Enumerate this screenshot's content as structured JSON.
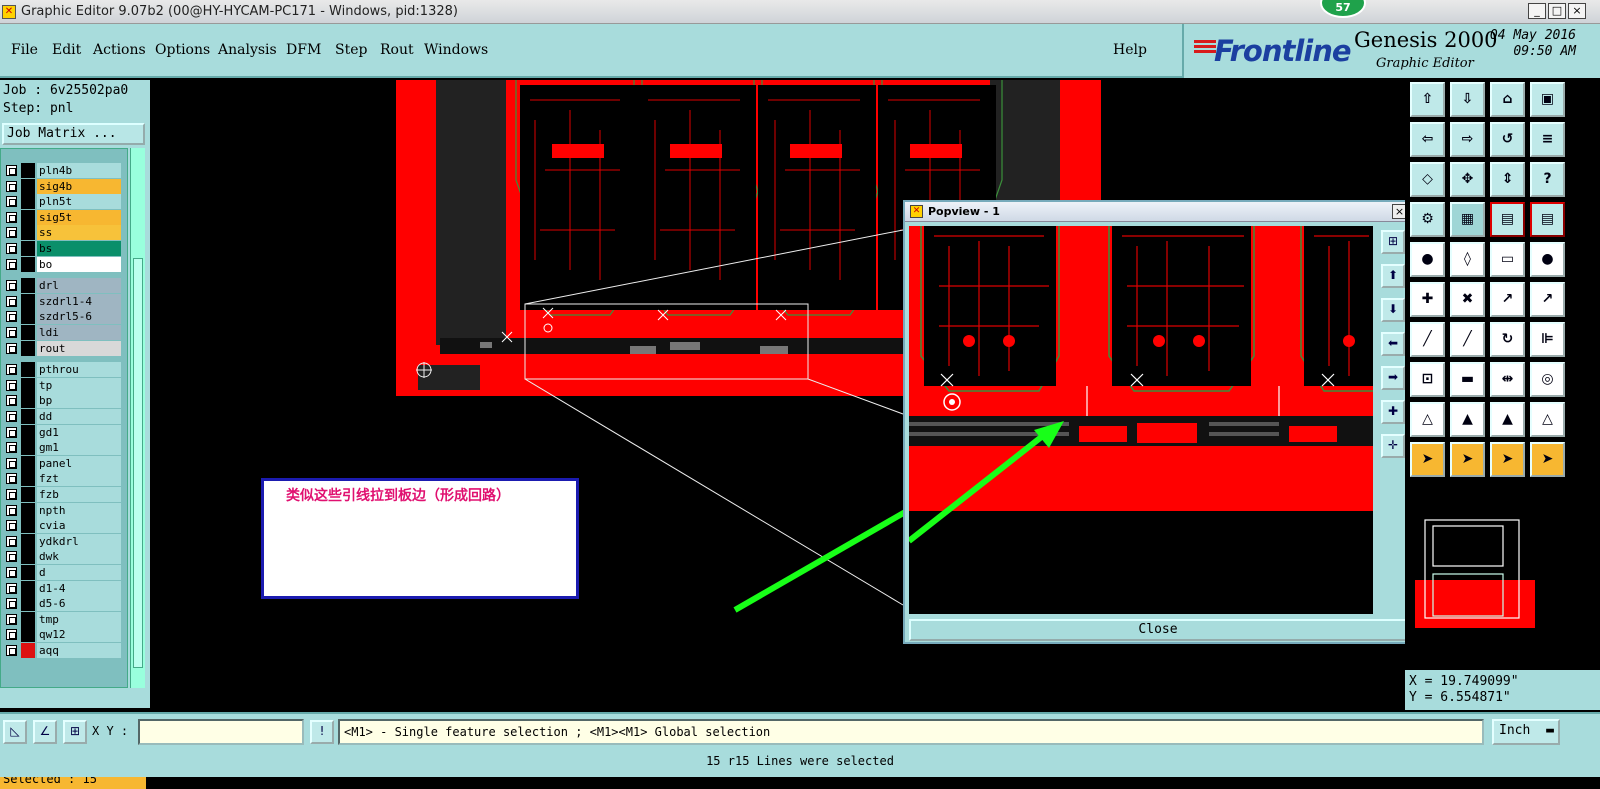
{
  "window": {
    "title": "Graphic Editor 9.07b2 (00@HY-HYCAM-PC171 - Windows, pid:1328)",
    "controls": [
      "_",
      "□",
      "×"
    ],
    "notification_count": "57"
  },
  "menu": [
    "File",
    "Edit",
    "Actions",
    "Options",
    "Analysis",
    "DFM",
    "Step",
    "Rout",
    "Windows"
  ],
  "help_label": "Help",
  "brand": {
    "logo": "Frontline",
    "product": "Genesis 2000",
    "subtitle": "Graphic Editor",
    "date": "04 May 2016",
    "time": "09:50 AM"
  },
  "job": {
    "job_line": "Job : 6v25502pa0",
    "step_line": "Step: pnl",
    "matrix_button": "Job Matrix ..."
  },
  "layers": [
    {
      "name": "pln4b",
      "color": "#a8dcdc"
    },
    {
      "name": "sig4b",
      "color": "#f7b731"
    },
    {
      "name": "pln5t",
      "color": "#a8dcdc"
    },
    {
      "name": "sig5t",
      "color": "#f7b731"
    },
    {
      "name": "ss",
      "color": "#f7c23a"
    },
    {
      "name": "bs",
      "color": "#0a8f6a"
    },
    {
      "name": "bo",
      "color": "#ffffff"
    },
    {
      "name": "drl",
      "color": "#9fb5c2"
    },
    {
      "name": "szdrl1-4",
      "color": "#9fb5c2"
    },
    {
      "name": "szdrl5-6",
      "color": "#9fb5c2"
    },
    {
      "name": "ldi",
      "color": "#9fb5c2"
    },
    {
      "name": "rout",
      "color": "#d8d8d8"
    },
    {
      "name": "pthrou",
      "color": "#a8dcdc"
    },
    {
      "name": "tp",
      "color": "#a8dcdc"
    },
    {
      "name": "bp",
      "color": "#a8dcdc"
    },
    {
      "name": "dd",
      "color": "#a8dcdc"
    },
    {
      "name": "gd1",
      "color": "#a8dcdc"
    },
    {
      "name": "gm1",
      "color": "#a8dcdc"
    },
    {
      "name": "panel",
      "color": "#a8dcdc"
    },
    {
      "name": "fzt",
      "color": "#a8dcdc"
    },
    {
      "name": "fzb",
      "color": "#a8dcdc"
    },
    {
      "name": "npth",
      "color": "#a8dcdc"
    },
    {
      "name": "cvia",
      "color": "#a8dcdc"
    },
    {
      "name": "ydkdrl",
      "color": "#a8dcdc"
    },
    {
      "name": "dwk",
      "color": "#a8dcdc"
    },
    {
      "name": "d",
      "color": "#a8dcdc"
    },
    {
      "name": "d1-4",
      "color": "#a8dcdc"
    },
    {
      "name": "d5-6",
      "color": "#a8dcdc"
    },
    {
      "name": "tmp",
      "color": "#a8dcdc"
    },
    {
      "name": "qw12",
      "color": "#a8dcdc"
    },
    {
      "name": "aqq",
      "color": "#a8dcdc"
    }
  ],
  "selected_text": "Selected : 15",
  "popview": {
    "title": "Popview - 1",
    "close_label": "Close"
  },
  "annotation": {
    "text": "类似这些引线拉到板边（形成回路）"
  },
  "coords": {
    "x": "X = 19.749099\"",
    "y": "Y = 6.554871\""
  },
  "bottom": {
    "xy_label": "X Y :",
    "xy_value": "",
    "message": "<M1> - Single feature selection ; <M1><M1> Global selection",
    "unit": "Inch"
  },
  "status_line": "15 r15 Lines were selected",
  "colors": {
    "copper": "#ff0000",
    "panel_bg": "#a8dcdc",
    "accent_orange": "#f7b731",
    "arrow_green": "#18ff18"
  }
}
